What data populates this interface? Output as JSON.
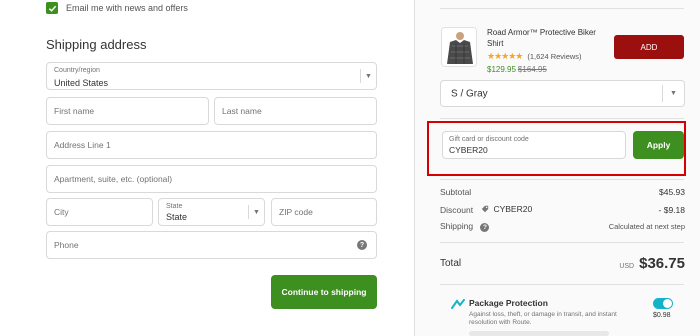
{
  "left": {
    "email_optin": {
      "checked": true,
      "label": "Email me with news and offers"
    },
    "section_title": "Shipping address",
    "country": {
      "label": "Country/region",
      "value": "United States"
    },
    "first_name": {
      "placeholder": "First name"
    },
    "last_name": {
      "placeholder": "Last name"
    },
    "address1": {
      "placeholder": "Address Line 1"
    },
    "address2": {
      "placeholder": "Apartment, suite, etc. (optional)"
    },
    "city": {
      "placeholder": "City"
    },
    "state": {
      "label": "State",
      "value": "State"
    },
    "zip": {
      "placeholder": "ZIP code"
    },
    "phone": {
      "placeholder": "Phone"
    },
    "continue_label": "Continue to shipping"
  },
  "right": {
    "product": {
      "name": "Road Armor™ Protective Biker Shirt",
      "stars": "★★★★★",
      "reviews": "(1,624 Reviews)",
      "price": "$129.95",
      "old_price": "$164.95",
      "add_label": "ADD"
    },
    "variant": {
      "value": "S / Gray"
    },
    "discount": {
      "label": "Gift card or discount code",
      "value": "CYBER20",
      "apply_label": "Apply"
    },
    "summary": {
      "subtotal_label": "Subtotal",
      "subtotal_value": "$45.93",
      "discount_label": "Discount",
      "discount_code": "CYBER20",
      "discount_value": "- $9.18",
      "shipping_label": "Shipping",
      "shipping_value": "Calculated at next step"
    },
    "total": {
      "label": "Total",
      "currency": "USD",
      "value": "$36.75"
    },
    "protection": {
      "title": "Package Protection",
      "description": "Against loss, theft, or damage in transit, and instant resolution with Route.",
      "enabled": true,
      "price": "$0.98"
    }
  },
  "colors": {
    "green": "#3d8f1f",
    "dark_red": "#9c0f0f",
    "highlight_red": "#d60000",
    "route_teal": "#15b3c9"
  }
}
